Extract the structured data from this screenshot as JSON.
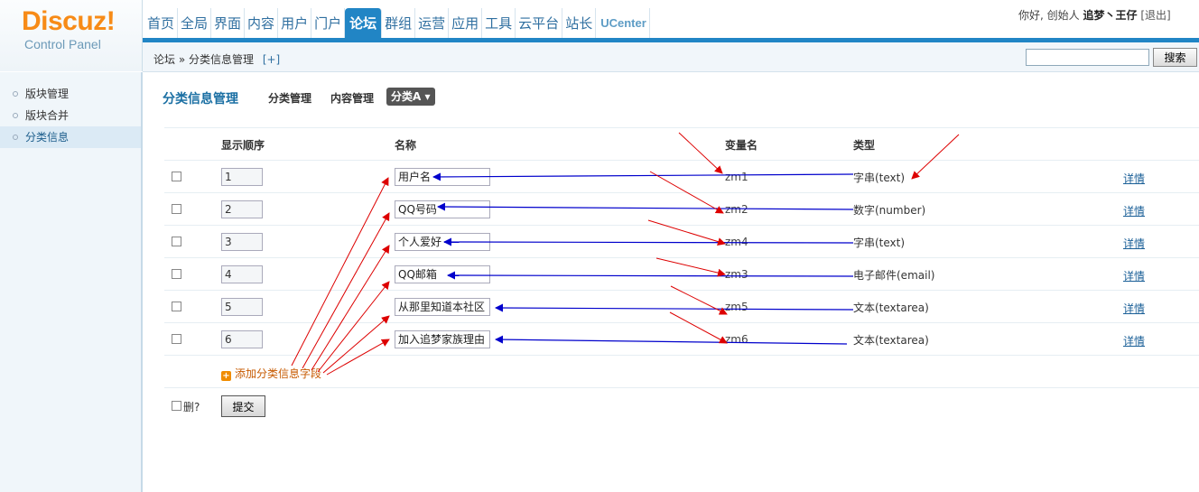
{
  "logo": {
    "brand": "Discuz!",
    "subtitle": "Control Panel"
  },
  "nav": [
    "首页",
    "全局",
    "界面",
    "内容",
    "用户",
    "门户",
    "论坛",
    "群组",
    "运营",
    "应用",
    "工具",
    "云平台",
    "站长",
    "UCenter"
  ],
  "nav_active": "论坛",
  "user": {
    "greeting": "你好, 创始人",
    "name": "追梦丶王仔",
    "logout": "[退出]"
  },
  "breadcrumb": {
    "text": "论坛 » 分类信息管理",
    "plus": "[+]"
  },
  "search": {
    "button": "搜索"
  },
  "sidebar": [
    {
      "label": "版块管理",
      "active": false
    },
    {
      "label": "版块合并",
      "active": false
    },
    {
      "label": "分类信息",
      "active": true
    }
  ],
  "page": {
    "title": "分类信息管理",
    "tabs": [
      "分类管理",
      "内容管理"
    ],
    "current_tab": "分类A ▾"
  },
  "table": {
    "headers": {
      "order": "显示顺序",
      "name": "名称",
      "var": "变量名",
      "type": "类型"
    },
    "rows": [
      {
        "order": "1",
        "name": "用户名",
        "var": "zm1",
        "type": "字串(text)",
        "detail": "详情"
      },
      {
        "order": "2",
        "name": "QQ号码",
        "var": "zm2",
        "type": "数字(number)",
        "detail": "详情"
      },
      {
        "order": "3",
        "name": "个人爱好",
        "var": "zm4",
        "type": "字串(text)",
        "detail": "详情"
      },
      {
        "order": "4",
        "name": "QQ邮箱",
        "var": "zm3",
        "type": "电子邮件(email)",
        "detail": "详情"
      },
      {
        "order": "5",
        "name": "从那里知道本社区",
        "var": "zm5",
        "type": "文本(textarea)",
        "detail": "详情"
      },
      {
        "order": "6",
        "name": "加入追梦家族理由",
        "var": "zm6",
        "type": "文本(textarea)",
        "detail": "详情"
      }
    ],
    "add_link": "添加分类信息字段"
  },
  "footer": {
    "delete_label": "删?",
    "submit": "提交"
  },
  "annotation_colors": {
    "red": "#dd0000",
    "blue": "#0000cc"
  }
}
